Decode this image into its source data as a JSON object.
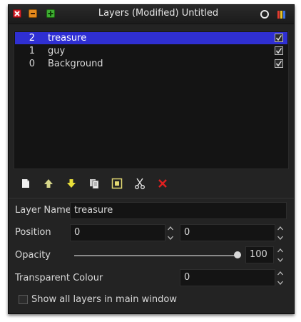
{
  "window": {
    "title": "Layers (Modified) Untitled"
  },
  "titlebar_icons": [
    "close-icon",
    "minimize-icon",
    "maximize-icon",
    "circle-icon",
    "palette-icon"
  ],
  "layers": [
    {
      "number": "2",
      "name": "treasure",
      "visible": true,
      "selected": true
    },
    {
      "number": "1",
      "name": "guy",
      "visible": true,
      "selected": false
    },
    {
      "number": "0",
      "name": "Background",
      "visible": true,
      "selected": false
    }
  ],
  "toolbar": {
    "icons": [
      "new-layer-icon",
      "move-up-icon",
      "move-down-icon",
      "duplicate-icon",
      "properties-icon",
      "cut-icon",
      "delete-icon"
    ]
  },
  "properties": {
    "layer_name_label": "Layer Name",
    "layer_name_value": "treasure",
    "position_label": "Position",
    "position_x": "0",
    "position_y": "0",
    "opacity_label": "Opacity",
    "opacity_value": "100",
    "opacity_fraction": 1.0,
    "transparent_colour_label": "Transparent Colour",
    "transparent_colour_value": "0",
    "show_all_label": "Show all layers in main window",
    "show_all_checked": false
  },
  "colors": {
    "selection": "#2f2fd2",
    "window_bg": "#232323",
    "list_bg": "#141414"
  }
}
